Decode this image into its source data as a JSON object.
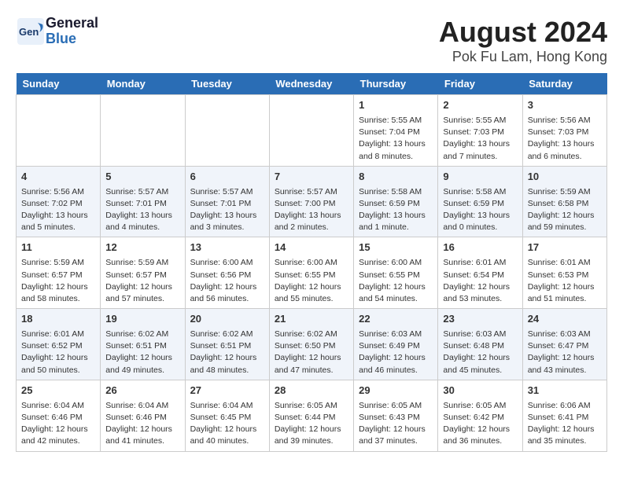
{
  "header": {
    "logo_general": "General",
    "logo_blue": "Blue",
    "title": "August 2024",
    "subtitle": "Pok Fu Lam, Hong Kong"
  },
  "days_of_week": [
    "Sunday",
    "Monday",
    "Tuesday",
    "Wednesday",
    "Thursday",
    "Friday",
    "Saturday"
  ],
  "weeks": [
    [
      {
        "day": "",
        "info": ""
      },
      {
        "day": "",
        "info": ""
      },
      {
        "day": "",
        "info": ""
      },
      {
        "day": "",
        "info": ""
      },
      {
        "day": "1",
        "info": "Sunrise: 5:55 AM\nSunset: 7:04 PM\nDaylight: 13 hours\nand 8 minutes."
      },
      {
        "day": "2",
        "info": "Sunrise: 5:55 AM\nSunset: 7:03 PM\nDaylight: 13 hours\nand 7 minutes."
      },
      {
        "day": "3",
        "info": "Sunrise: 5:56 AM\nSunset: 7:03 PM\nDaylight: 13 hours\nand 6 minutes."
      }
    ],
    [
      {
        "day": "4",
        "info": "Sunrise: 5:56 AM\nSunset: 7:02 PM\nDaylight: 13 hours\nand 5 minutes."
      },
      {
        "day": "5",
        "info": "Sunrise: 5:57 AM\nSunset: 7:01 PM\nDaylight: 13 hours\nand 4 minutes."
      },
      {
        "day": "6",
        "info": "Sunrise: 5:57 AM\nSunset: 7:01 PM\nDaylight: 13 hours\nand 3 minutes."
      },
      {
        "day": "7",
        "info": "Sunrise: 5:57 AM\nSunset: 7:00 PM\nDaylight: 13 hours\nand 2 minutes."
      },
      {
        "day": "8",
        "info": "Sunrise: 5:58 AM\nSunset: 6:59 PM\nDaylight: 13 hours\nand 1 minute."
      },
      {
        "day": "9",
        "info": "Sunrise: 5:58 AM\nSunset: 6:59 PM\nDaylight: 13 hours\nand 0 minutes."
      },
      {
        "day": "10",
        "info": "Sunrise: 5:59 AM\nSunset: 6:58 PM\nDaylight: 12 hours\nand 59 minutes."
      }
    ],
    [
      {
        "day": "11",
        "info": "Sunrise: 5:59 AM\nSunset: 6:57 PM\nDaylight: 12 hours\nand 58 minutes."
      },
      {
        "day": "12",
        "info": "Sunrise: 5:59 AM\nSunset: 6:57 PM\nDaylight: 12 hours\nand 57 minutes."
      },
      {
        "day": "13",
        "info": "Sunrise: 6:00 AM\nSunset: 6:56 PM\nDaylight: 12 hours\nand 56 minutes."
      },
      {
        "day": "14",
        "info": "Sunrise: 6:00 AM\nSunset: 6:55 PM\nDaylight: 12 hours\nand 55 minutes."
      },
      {
        "day": "15",
        "info": "Sunrise: 6:00 AM\nSunset: 6:55 PM\nDaylight: 12 hours\nand 54 minutes."
      },
      {
        "day": "16",
        "info": "Sunrise: 6:01 AM\nSunset: 6:54 PM\nDaylight: 12 hours\nand 53 minutes."
      },
      {
        "day": "17",
        "info": "Sunrise: 6:01 AM\nSunset: 6:53 PM\nDaylight: 12 hours\nand 51 minutes."
      }
    ],
    [
      {
        "day": "18",
        "info": "Sunrise: 6:01 AM\nSunset: 6:52 PM\nDaylight: 12 hours\nand 50 minutes."
      },
      {
        "day": "19",
        "info": "Sunrise: 6:02 AM\nSunset: 6:51 PM\nDaylight: 12 hours\nand 49 minutes."
      },
      {
        "day": "20",
        "info": "Sunrise: 6:02 AM\nSunset: 6:51 PM\nDaylight: 12 hours\nand 48 minutes."
      },
      {
        "day": "21",
        "info": "Sunrise: 6:02 AM\nSunset: 6:50 PM\nDaylight: 12 hours\nand 47 minutes."
      },
      {
        "day": "22",
        "info": "Sunrise: 6:03 AM\nSunset: 6:49 PM\nDaylight: 12 hours\nand 46 minutes."
      },
      {
        "day": "23",
        "info": "Sunrise: 6:03 AM\nSunset: 6:48 PM\nDaylight: 12 hours\nand 45 minutes."
      },
      {
        "day": "24",
        "info": "Sunrise: 6:03 AM\nSunset: 6:47 PM\nDaylight: 12 hours\nand 43 minutes."
      }
    ],
    [
      {
        "day": "25",
        "info": "Sunrise: 6:04 AM\nSunset: 6:46 PM\nDaylight: 12 hours\nand 42 minutes."
      },
      {
        "day": "26",
        "info": "Sunrise: 6:04 AM\nSunset: 6:46 PM\nDaylight: 12 hours\nand 41 minutes."
      },
      {
        "day": "27",
        "info": "Sunrise: 6:04 AM\nSunset: 6:45 PM\nDaylight: 12 hours\nand 40 minutes."
      },
      {
        "day": "28",
        "info": "Sunrise: 6:05 AM\nSunset: 6:44 PM\nDaylight: 12 hours\nand 39 minutes."
      },
      {
        "day": "29",
        "info": "Sunrise: 6:05 AM\nSunset: 6:43 PM\nDaylight: 12 hours\nand 37 minutes."
      },
      {
        "day": "30",
        "info": "Sunrise: 6:05 AM\nSunset: 6:42 PM\nDaylight: 12 hours\nand 36 minutes."
      },
      {
        "day": "31",
        "info": "Sunrise: 6:06 AM\nSunset: 6:41 PM\nDaylight: 12 hours\nand 35 minutes."
      }
    ]
  ]
}
